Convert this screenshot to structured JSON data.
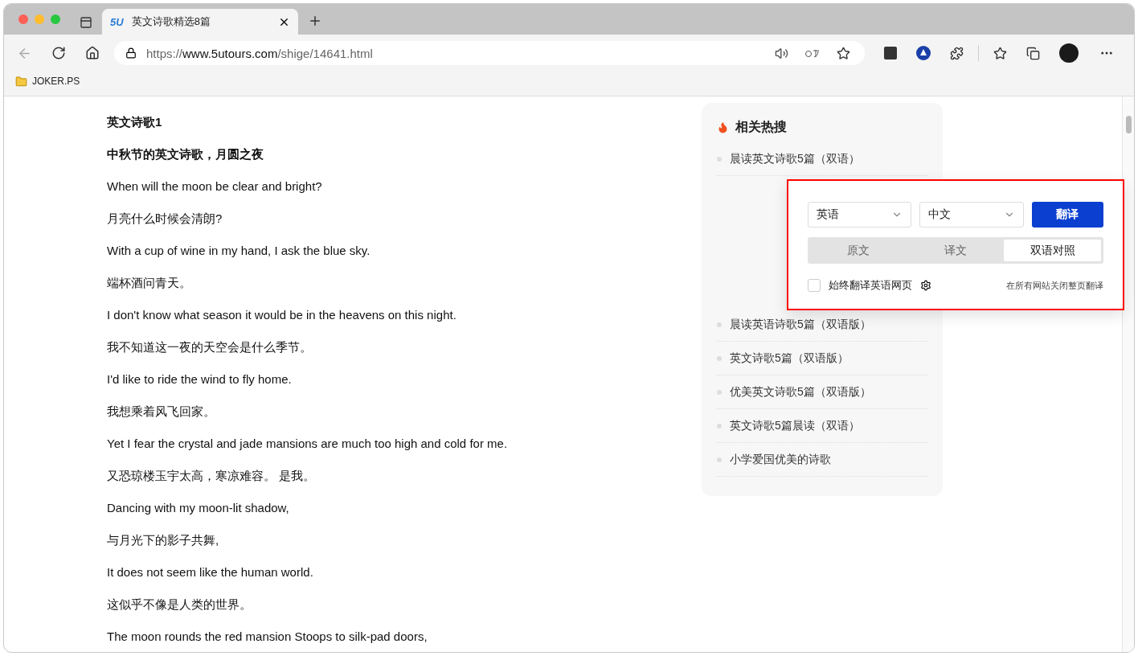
{
  "browser": {
    "site_logo": "5U",
    "tab_title": "英文诗歌精选8篇",
    "url_scheme": "https://",
    "url_host": "www.5utours.com",
    "url_path": "/shige/14641.html",
    "bookmarks": [
      "JOKER.PS"
    ]
  },
  "article": {
    "paragraphs": [
      {
        "kind": "heading",
        "text": "英文诗歌1"
      },
      {
        "kind": "heading",
        "text": "中秋节的英文诗歌，月圆之夜"
      },
      {
        "kind": "text",
        "text": "When will the moon be clear and bright?"
      },
      {
        "kind": "text",
        "text": "月亮什么时候会清朗?"
      },
      {
        "kind": "text",
        "text": "With a cup of wine in my hand, I ask the blue sky."
      },
      {
        "kind": "text",
        "text": "端杯酒问青天。"
      },
      {
        "kind": "text",
        "text": "I don't know what season it would be in the heavens on this night."
      },
      {
        "kind": "text",
        "text": "我不知道这一夜的天空会是什么季节。"
      },
      {
        "kind": "text",
        "text": "I'd like to ride the wind to fly home."
      },
      {
        "kind": "text",
        "text": "我想乘着风飞回家。"
      },
      {
        "kind": "text",
        "text": "Yet I fear the crystal and jade mansions are much too high and cold for me."
      },
      {
        "kind": "text",
        "text": "又恐琼楼玉宇太高，寒凉难容。 是我。"
      },
      {
        "kind": "text",
        "text": "Dancing with my moon-lit shadow,"
      },
      {
        "kind": "text",
        "text": "与月光下的影子共舞,"
      },
      {
        "kind": "text",
        "text": "It does not seem like the human world."
      },
      {
        "kind": "text",
        "text": "这似乎不像是人类的世界。"
      },
      {
        "kind": "text",
        "text": "The moon rounds the red mansion Stoops to silk-pad doors,"
      }
    ]
  },
  "sidebar": {
    "title": "相关热搜",
    "items": [
      "晨读英文诗歌5篇（双语）",
      "晨读英语诗歌5篇（双语版）",
      "英文诗歌5篇（双语版）",
      "优美英文诗歌5篇（双语版）",
      "英文诗歌5篇晨读（双语）",
      "小学爱国优美的诗歌"
    ]
  },
  "translate_popup": {
    "source_language": "英语",
    "target_language": "中文",
    "translate_button": "翻译",
    "modes": [
      {
        "label": "原文",
        "selected": false
      },
      {
        "label": "译文",
        "selected": false
      },
      {
        "label": "双语对照",
        "selected": true
      }
    ],
    "always_translate": {
      "label": "始终翻译英语网页",
      "checked": false
    },
    "disable_link": "在所有网站关闭整页翻译"
  }
}
